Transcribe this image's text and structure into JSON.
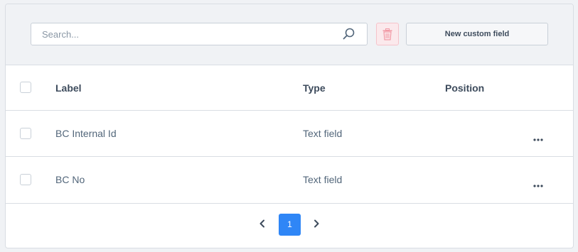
{
  "toolbar": {
    "search_placeholder": "Search...",
    "search_icon": "search-icon",
    "delete_icon": "trash-icon",
    "new_button_label": "New custom field"
  },
  "table": {
    "columns": [
      "Label",
      "Type",
      "Position"
    ],
    "rows": [
      {
        "label": "BC Internal Id",
        "type": "Text field",
        "position": ""
      },
      {
        "label": "BC No",
        "type": "Text field",
        "position": ""
      }
    ],
    "row_action_icon": "more-horizontal-icon"
  },
  "pagination": {
    "current_page": "1",
    "prev_icon": "chevron-left-icon",
    "next_icon": "chevron-right-icon"
  },
  "colors": {
    "accent": "#2f86f6",
    "background": "#f0f2f5",
    "danger_light": "#fbe9ec",
    "text": "#52667a"
  }
}
